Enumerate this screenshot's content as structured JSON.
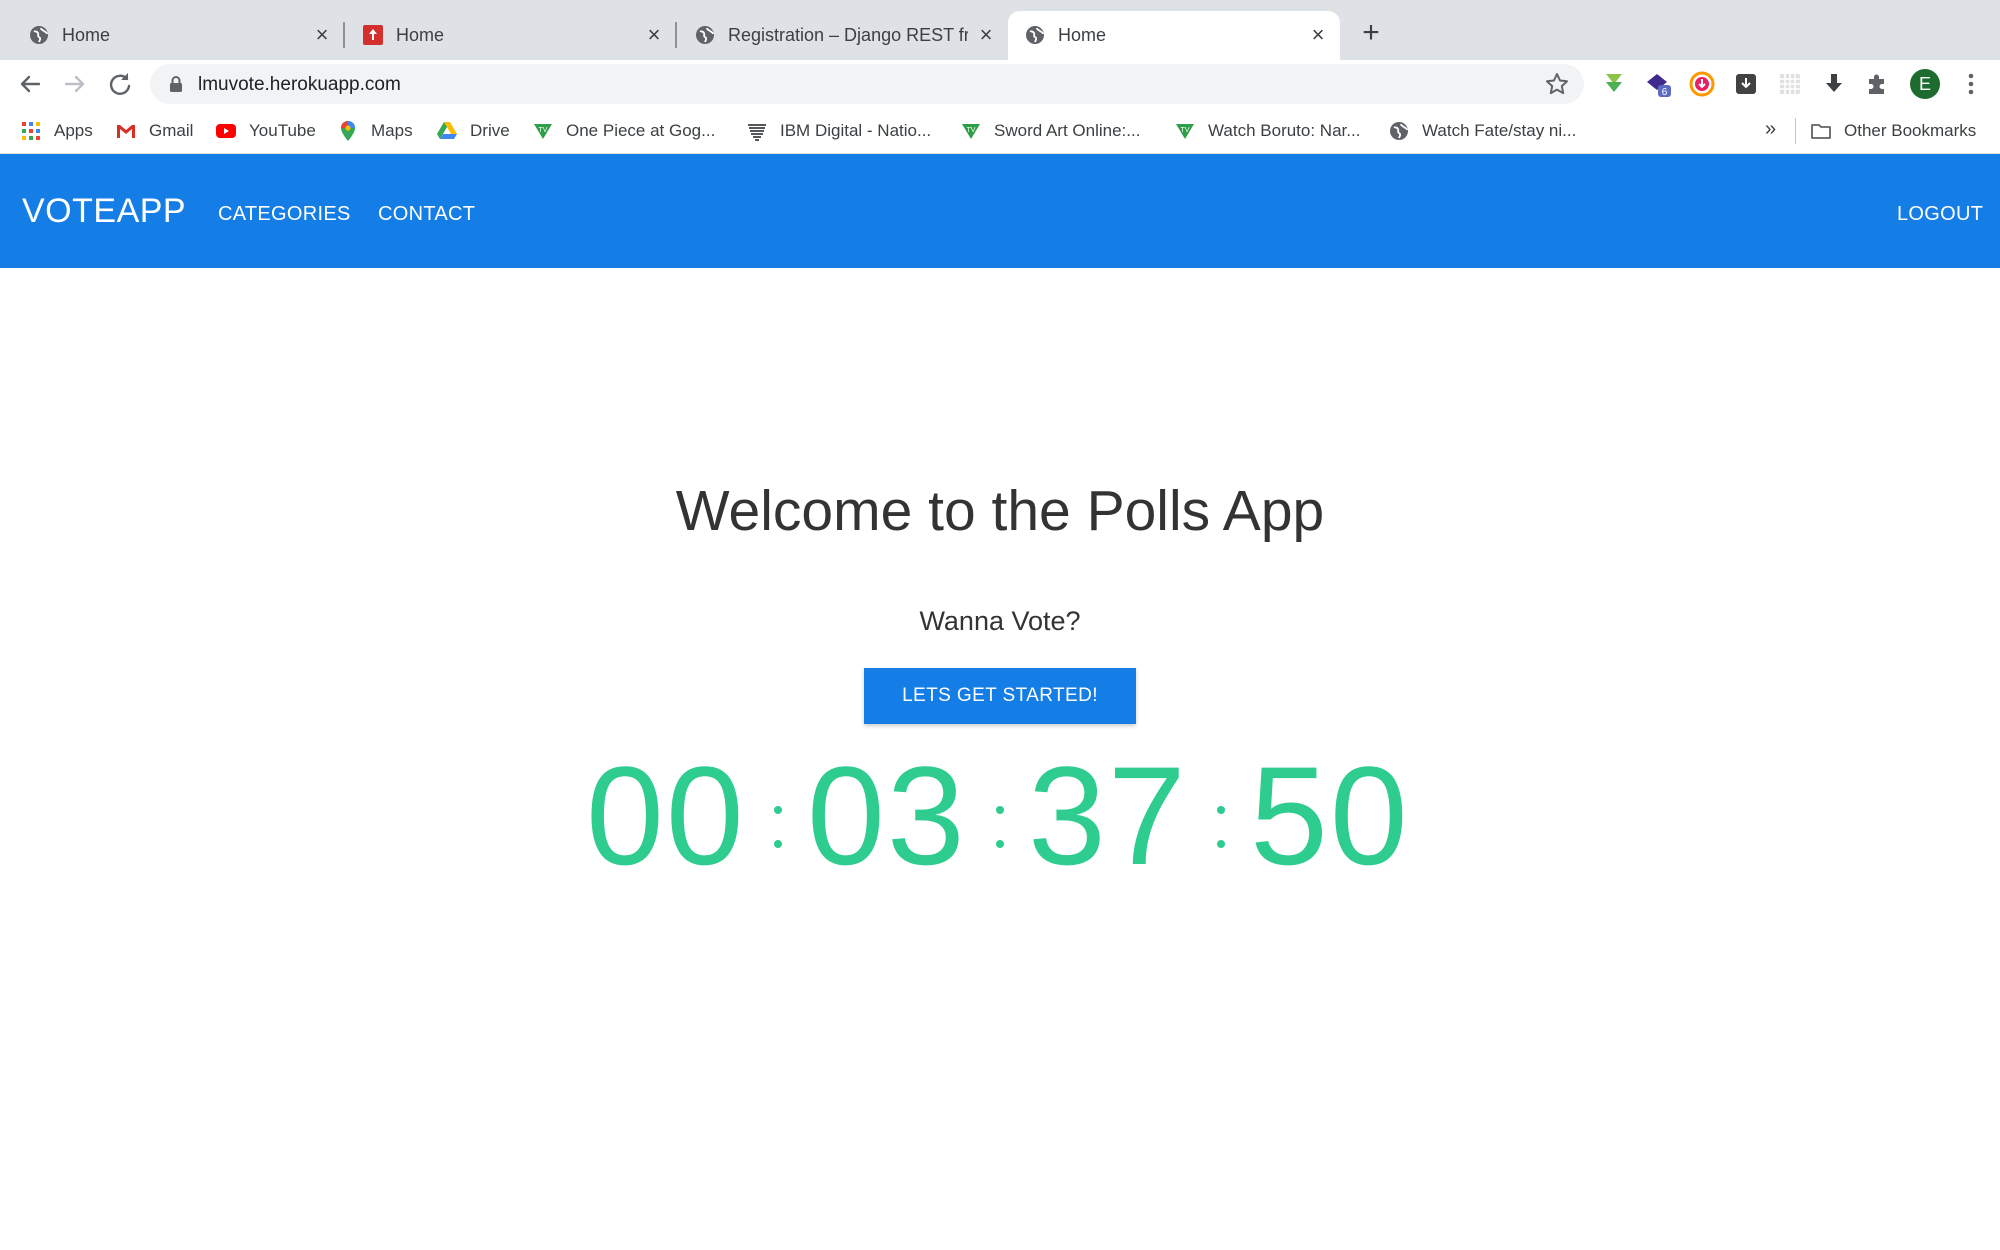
{
  "browser": {
    "tabs": [
      {
        "title": "Home"
      },
      {
        "title": "Home"
      },
      {
        "title": "Registration – Django REST fra"
      },
      {
        "title": "Home"
      }
    ],
    "url": "lmuvote.herokuapp.com",
    "profile_initial": "E",
    "extension_badge": "6",
    "bookmarks": [
      {
        "label": "Apps",
        "icon": "apps-grid-icon"
      },
      {
        "label": "Gmail",
        "icon": "gmail-icon"
      },
      {
        "label": "YouTube",
        "icon": "youtube-icon"
      },
      {
        "label": "Maps",
        "icon": "maps-pin-icon"
      },
      {
        "label": "Drive",
        "icon": "drive-icon"
      },
      {
        "label": "One Piece at Gog...",
        "icon": "tv-icon"
      },
      {
        "label": "IBM Digital - Natio...",
        "icon": "ibm-icon"
      },
      {
        "label": "Sword Art Online:...",
        "icon": "tv-icon"
      },
      {
        "label": "Watch Boruto: Nar...",
        "icon": "tv-icon"
      },
      {
        "label": "Watch Fate/stay ni...",
        "icon": "globe-icon"
      }
    ],
    "overflow": "»",
    "other_bookmarks": "Other Bookmarks"
  },
  "app": {
    "brand": "VOTEAPP",
    "nav": {
      "categories": "CATEGORIES",
      "contact": "CONTACT",
      "logout": "LOGOUT"
    },
    "heading": "Welcome to the Polls App",
    "subheading": "Wanna Vote?",
    "cta": "LETS GET STARTED!",
    "countdown": {
      "days": "00",
      "hours": "03",
      "minutes": "37",
      "seconds": "50"
    }
  },
  "colors": {
    "primary": "#147de6",
    "countdown": "#2ecc8f",
    "text": "#333333"
  }
}
